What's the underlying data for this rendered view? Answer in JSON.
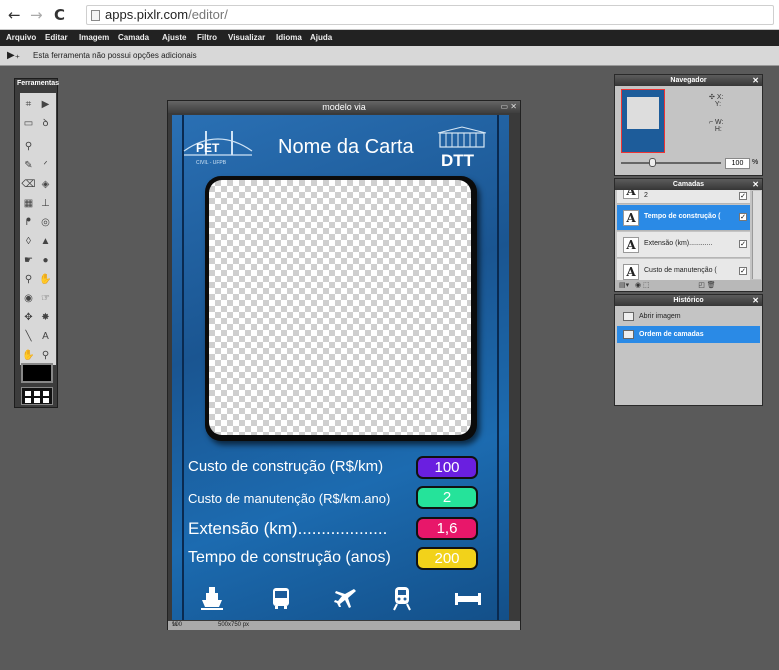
{
  "browser": {
    "url_host": "apps.pixlr.com",
    "url_path": "/editor/",
    "back": "←",
    "forward": "→",
    "reload": "C"
  },
  "menu": [
    "Arquivo",
    "Editar",
    "Imagem",
    "Camada",
    "Ajuste",
    "Filtro",
    "Visualizar",
    "Idioma",
    "Ajuda"
  ],
  "options_bar": {
    "message": "Esta ferramenta não possui opções adicionais"
  },
  "tools": {
    "title": "Ferramentas",
    "icons": [
      "crop-icon",
      "move-icon",
      "marquee-icon",
      "lasso-icon",
      "wand-icon",
      "blank",
      "pencil-icon",
      "brush-icon",
      "eraser-icon",
      "bucket-icon",
      "gradient-icon",
      "stamp-icon",
      "colorpicker-icon",
      "sponge-icon",
      "drop-icon",
      "sharpen-icon",
      "smudge-icon",
      "dodge-icon",
      "zoom-bulb-icon",
      "burn-icon",
      "eye-icon",
      "hand-smudge-icon",
      "pinch-icon",
      "bloat-icon",
      "line-icon",
      "text-icon",
      "hand-icon",
      "magnifier-icon"
    ],
    "text_glyph": "A"
  },
  "document": {
    "title": "modelo via",
    "zoom": "100",
    "zoom_unit": "%",
    "size": "500x750 px"
  },
  "card": {
    "title": "Nome da Carta",
    "logo_left": "PET",
    "logo_left_sub": "CIVIL - UFPB",
    "logo_right": "DTT",
    "stats": [
      {
        "label": "Custo de construção (R$/km)",
        "value": "100",
        "color": "#6a1fe0"
      },
      {
        "label": "Custo de manutenção (R$/km.ano)",
        "value": "2",
        "color": "#25e39a"
      },
      {
        "label": "Extensão (km)...................",
        "value": "1,6",
        "color": "#e8176a"
      },
      {
        "label": "Tempo de construção (anos)",
        "value": "200",
        "color": "#f2d21a"
      }
    ],
    "icons": [
      "ship-icon",
      "bus-icon",
      "airplane-icon",
      "train-icon",
      "bridge-icon"
    ]
  },
  "navigator": {
    "title": "Navegador",
    "x_label": "X:",
    "y_label": "Y:",
    "w_label": "W:",
    "h_label": "H:",
    "zoom": "100",
    "zoom_unit": "%"
  },
  "layers": {
    "title": "Camadas",
    "items": [
      {
        "name": "2",
        "selected": false
      },
      {
        "name": "Tempo de construção (",
        "selected": true
      },
      {
        "name": "Extensão (km)............",
        "selected": false
      },
      {
        "name": "Custo de manutenção (",
        "selected": false
      }
    ]
  },
  "history": {
    "title": "Histórico",
    "items": [
      {
        "name": "Abrir imagem",
        "selected": false
      },
      {
        "name": "Ordem de camadas",
        "selected": true
      }
    ]
  }
}
